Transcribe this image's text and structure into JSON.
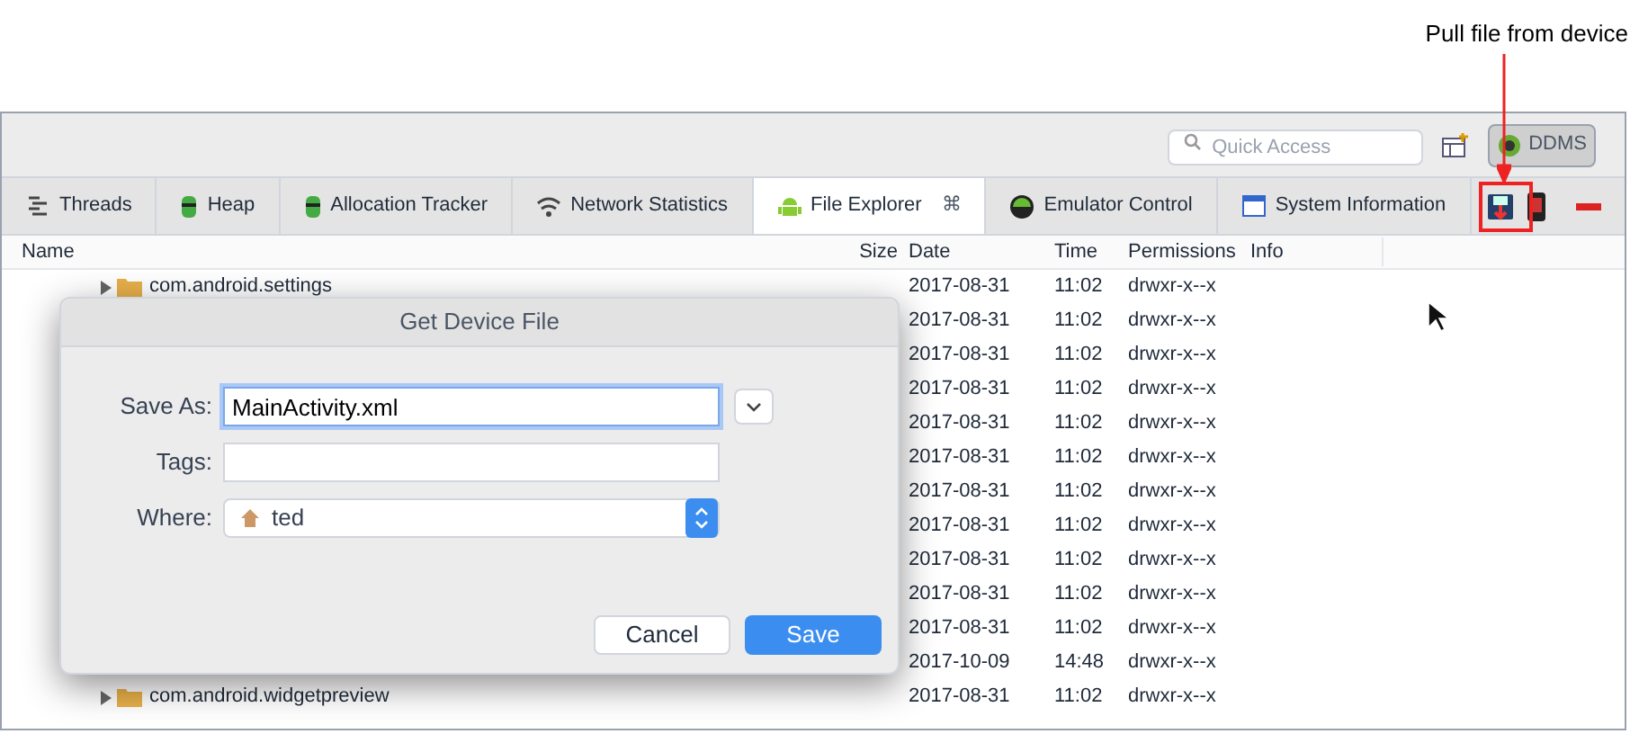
{
  "annotation": {
    "label": "Pull file from device"
  },
  "toolbar": {
    "search": {
      "placeholder": "Quick Access"
    },
    "perspective": {
      "label": "DDMS",
      "selected": true
    }
  },
  "tabs": [
    {
      "label": "Threads",
      "selected": false
    },
    {
      "label": "Heap",
      "selected": false
    },
    {
      "label": "Allocation Tracker",
      "selected": false
    },
    {
      "label": "Network Statistics",
      "selected": false
    },
    {
      "label": "File Explorer",
      "selected": true,
      "close": "⌘"
    },
    {
      "label": "Emulator Control",
      "selected": false
    },
    {
      "label": "System Information",
      "selected": false
    }
  ],
  "table": {
    "columns": [
      "Name",
      "Size",
      "Date",
      "Time",
      "Permissions",
      "Info"
    ],
    "rows": [
      {
        "name": "com.android.settings",
        "date": "2017-08-31",
        "time": "11:02",
        "permissions": "drwxr-x--x"
      },
      {
        "date": "2017-08-31",
        "time": "11:02",
        "permissions": "drwxr-x--x"
      },
      {
        "date": "2017-08-31",
        "time": "11:02",
        "permissions": "drwxr-x--x"
      },
      {
        "date": "2017-08-31",
        "time": "11:02",
        "permissions": "drwxr-x--x"
      },
      {
        "date": "2017-08-31",
        "time": "11:02",
        "permissions": "drwxr-x--x"
      },
      {
        "date": "2017-08-31",
        "time": "11:02",
        "permissions": "drwxr-x--x"
      },
      {
        "date": "2017-08-31",
        "time": "11:02",
        "permissions": "drwxr-x--x"
      },
      {
        "date": "2017-08-31",
        "time": "11:02",
        "permissions": "drwxr-x--x"
      },
      {
        "date": "2017-08-31",
        "time": "11:02",
        "permissions": "drwxr-x--x"
      },
      {
        "date": "2017-08-31",
        "time": "11:02",
        "permissions": "drwxr-x--x"
      },
      {
        "date": "2017-08-31",
        "time": "11:02",
        "permissions": "drwxr-x--x"
      },
      {
        "date": "2017-10-09",
        "time": "14:48",
        "permissions": "drwxr-x--x"
      },
      {
        "name": "com.android.widgetpreview",
        "date": "2017-08-31",
        "time": "11:02",
        "permissions": "drwxr-x--x"
      }
    ]
  },
  "dialog": {
    "title": "Get Device File",
    "fields": [
      {
        "label": "Save As:",
        "value": "MainActivity.xml",
        "kind": "text"
      },
      {
        "label": "Tags:",
        "kind": "text"
      },
      {
        "label": "Where:",
        "value": "ted",
        "kind": "popup"
      }
    ],
    "buttons": [
      {
        "label": "Cancel",
        "kind": "secondary"
      },
      {
        "label": "Save",
        "kind": "primary"
      }
    ]
  }
}
